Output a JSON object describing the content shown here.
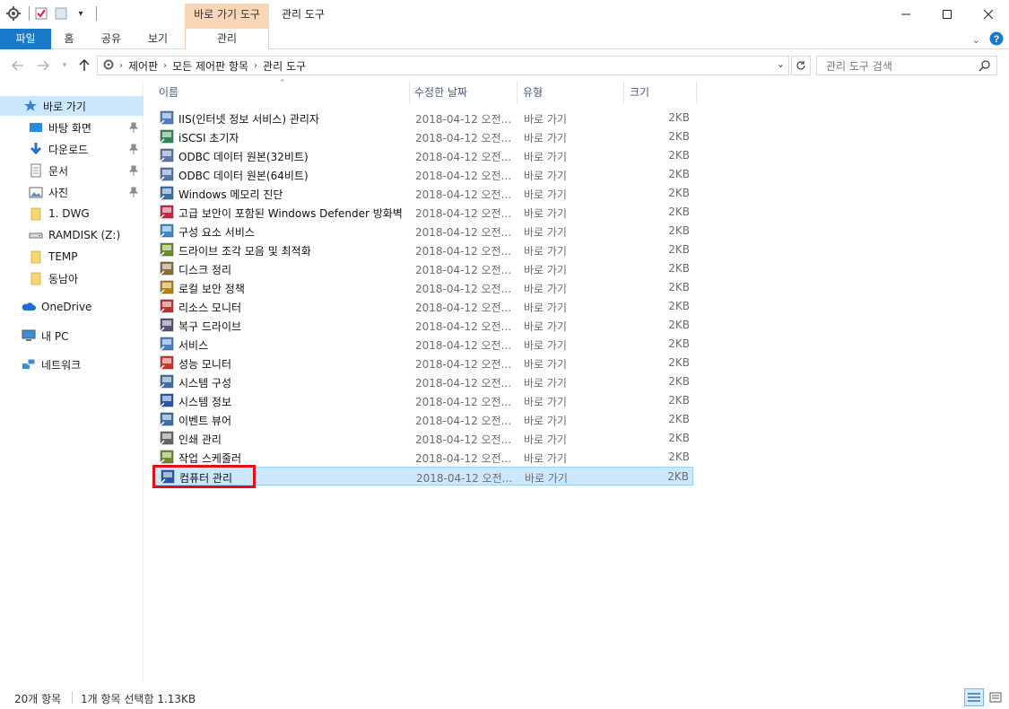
{
  "titlebar": {
    "context_tab": "바로 가기 도구",
    "title": "관리 도구"
  },
  "ribbon": {
    "tabs": [
      "파일",
      "홈",
      "공유",
      "보기",
      "관리"
    ]
  },
  "address": {
    "crumbs": [
      "제어판",
      "모든 제어판 항목",
      "관리 도구"
    ],
    "search_placeholder": "관리 도구 검색"
  },
  "nav": {
    "items": [
      {
        "label": "바로 가기",
        "icon": "star-icon"
      },
      {
        "label": "바탕 화면",
        "icon": "desktop-icon"
      },
      {
        "label": "다운로드",
        "icon": "download-icon"
      },
      {
        "label": "문서",
        "icon": "document-icon"
      },
      {
        "label": "사진",
        "icon": "picture-icon"
      },
      {
        "label": "1. DWG",
        "icon": "folder-icon"
      },
      {
        "label": "RAMDISK (Z:)",
        "icon": "drive-icon"
      },
      {
        "label": "TEMP",
        "icon": "folder-icon"
      },
      {
        "label": "동남아",
        "icon": "folder-icon"
      },
      {
        "label": "OneDrive",
        "icon": "cloud-icon"
      },
      {
        "label": "내 PC",
        "icon": "pc-icon"
      },
      {
        "label": "네트워크",
        "icon": "network-icon"
      }
    ]
  },
  "columns": {
    "name": "이름",
    "modified": "수정한 날짜",
    "type": "유형",
    "size": "크기"
  },
  "files": [
    {
      "name": "IIS(인터넷 정보 서비스) 관리자",
      "date": "2018-04-12 오전...",
      "type": "바로 가기",
      "size": "2KB"
    },
    {
      "name": "iSCSI 초기자",
      "date": "2018-04-12 오전...",
      "type": "바로 가기",
      "size": "2KB"
    },
    {
      "name": "ODBC 데이터 원본(32비트)",
      "date": "2018-04-12 오전...",
      "type": "바로 가기",
      "size": "2KB"
    },
    {
      "name": "ODBC 데이터 원본(64비트)",
      "date": "2018-04-12 오전...",
      "type": "바로 가기",
      "size": "2KB"
    },
    {
      "name": "Windows 메모리 진단",
      "date": "2018-04-12 오전...",
      "type": "바로 가기",
      "size": "2KB"
    },
    {
      "name": "고급 보안이 포함된 Windows Defender 방화벽",
      "date": "2018-04-12 오전...",
      "type": "바로 가기",
      "size": "2KB"
    },
    {
      "name": "구성 요소 서비스",
      "date": "2018-04-12 오전...",
      "type": "바로 가기",
      "size": "2KB"
    },
    {
      "name": "드라이브 조각 모음 및 최적화",
      "date": "2018-04-12 오전...",
      "type": "바로 가기",
      "size": "2KB"
    },
    {
      "name": "디스크 정리",
      "date": "2018-04-12 오전...",
      "type": "바로 가기",
      "size": "2KB"
    },
    {
      "name": "로컬 보안 정책",
      "date": "2018-04-12 오전...",
      "type": "바로 가기",
      "size": "2KB"
    },
    {
      "name": "리소스 모니터",
      "date": "2018-04-12 오전...",
      "type": "바로 가기",
      "size": "2KB"
    },
    {
      "name": "복구 드라이브",
      "date": "2018-04-12 오전...",
      "type": "바로 가기",
      "size": "2KB"
    },
    {
      "name": "서비스",
      "date": "2018-04-12 오전...",
      "type": "바로 가기",
      "size": "2KB"
    },
    {
      "name": "성능 모니터",
      "date": "2018-04-12 오전...",
      "type": "바로 가기",
      "size": "2KB"
    },
    {
      "name": "시스템 구성",
      "date": "2018-04-12 오전...",
      "type": "바로 가기",
      "size": "2KB"
    },
    {
      "name": "시스템 정보",
      "date": "2018-04-12 오전...",
      "type": "바로 가기",
      "size": "2KB"
    },
    {
      "name": "이벤트 뷰어",
      "date": "2018-04-12 오전...",
      "type": "바로 가기",
      "size": "2KB"
    },
    {
      "name": "인쇄 관리",
      "date": "2018-04-12 오전...",
      "type": "바로 가기",
      "size": "2KB"
    },
    {
      "name": "작업 스케줄러",
      "date": "2018-04-12 오전...",
      "type": "바로 가기",
      "size": "2KB"
    },
    {
      "name": "컴퓨터 관리",
      "date": "2018-04-12 오전...",
      "type": "바로 가기",
      "size": "2KB"
    }
  ],
  "status": {
    "count": "20개 항목",
    "selection": "1개 항목 선택함 1.13KB"
  },
  "colors": {
    "accent": "#1979ca",
    "selection": "#cce8ff",
    "context_tab": "#f9d6b6",
    "highlight": "#e0101a"
  }
}
